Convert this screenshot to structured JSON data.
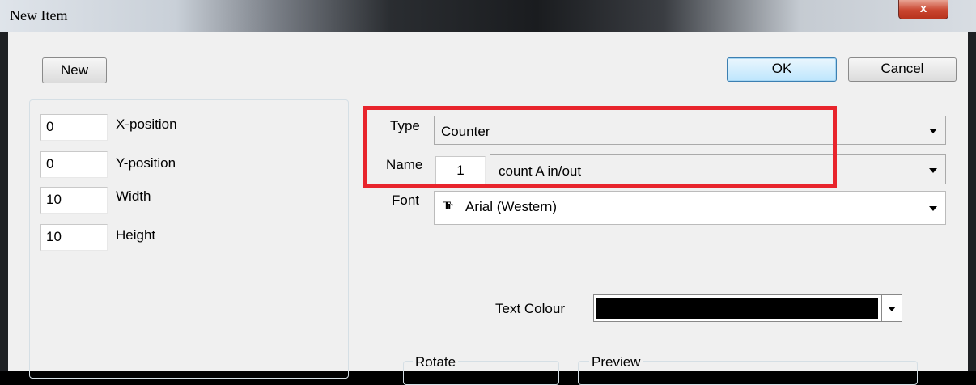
{
  "window": {
    "title": "New Item",
    "close_glyph": "x"
  },
  "toolbar": {
    "new_label": "New",
    "ok_label": "OK",
    "cancel_label": "Cancel"
  },
  "geometry": {
    "fields": [
      {
        "value": "0",
        "label": "X-position"
      },
      {
        "value": "0",
        "label": "Y-position"
      },
      {
        "value": "10",
        "label": "Width"
      },
      {
        "value": "10",
        "label": "Height"
      }
    ]
  },
  "properties": {
    "type_label": "Type",
    "type_value": "Counter",
    "name_label": "Name",
    "name_number": "1",
    "name_value": "count A in/out",
    "font_label": "Font",
    "font_icon_glyph": "Tr",
    "font_value": "Arial (Western)",
    "text_colour_label": "Text Colour",
    "text_colour_value": "#000000"
  },
  "groups": {
    "rotate_label": "Rotate",
    "preview_label": "Preview"
  },
  "colors": {
    "highlight": "#e8242c"
  }
}
